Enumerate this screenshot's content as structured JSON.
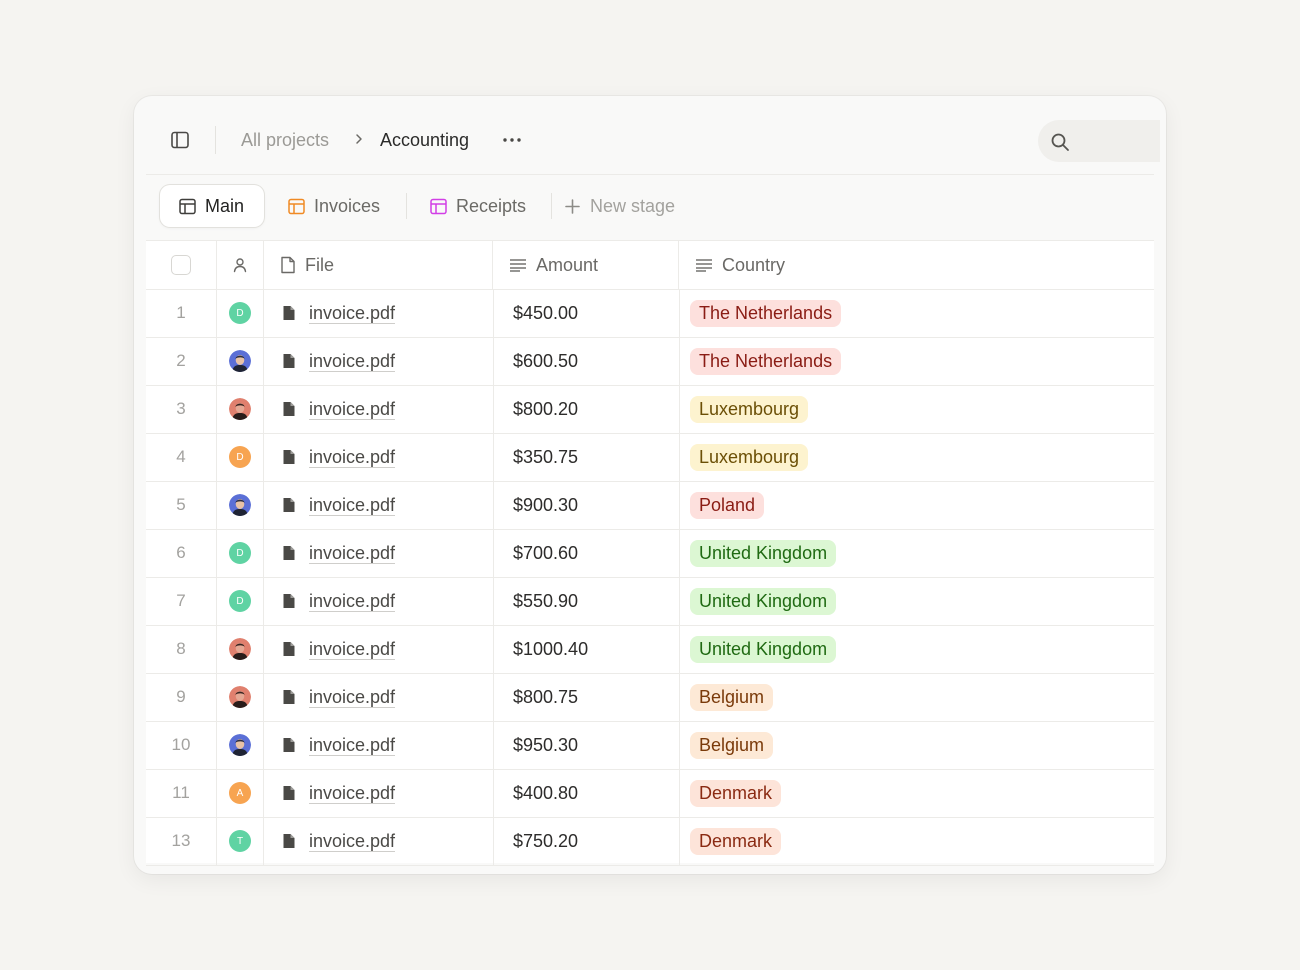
{
  "breadcrumb": {
    "root": "All projects",
    "current": "Accounting"
  },
  "icons": {
    "sidebar_toggle": "sidebar-toggle-icon",
    "more": "more-horizontal-icon",
    "search": "search-icon",
    "chevron": "chevron-right-icon"
  },
  "tabs": [
    {
      "label": "Main",
      "icon": "table-icon",
      "active": true,
      "color": "#6b6a66"
    },
    {
      "label": "Invoices",
      "icon": "table-icon",
      "active": false,
      "color": "#f08a24"
    },
    {
      "label": "Receipts",
      "icon": "table-icon",
      "active": false,
      "color": "#d23fe6"
    },
    {
      "label": "New stage",
      "icon": "plus-icon",
      "active": false
    }
  ],
  "table": {
    "columns": {
      "file": "File",
      "amount": "Amount",
      "country": "Country"
    },
    "rows": [
      {
        "num": "1",
        "avatar": {
          "type": "initial",
          "letter": "D",
          "color": "#5fd3a3"
        },
        "file": "invoice.pdf",
        "amount": "$450.00",
        "country": "The Netherlands"
      },
      {
        "num": "2",
        "avatar": {
          "type": "photo",
          "tone": "blue"
        },
        "file": "invoice.pdf",
        "amount": "$600.50",
        "country": "The Netherlands"
      },
      {
        "num": "3",
        "avatar": {
          "type": "photo",
          "tone": "red"
        },
        "file": "invoice.pdf",
        "amount": "$800.20",
        "country": "Luxembourg"
      },
      {
        "num": "4",
        "avatar": {
          "type": "initial",
          "letter": "D",
          "color": "#f7a451"
        },
        "file": "invoice.pdf",
        "amount": "$350.75",
        "country": "Luxembourg"
      },
      {
        "num": "5",
        "avatar": {
          "type": "photo",
          "tone": "blue"
        },
        "file": "invoice.pdf",
        "amount": "$900.30",
        "country": "Poland"
      },
      {
        "num": "6",
        "avatar": {
          "type": "initial",
          "letter": "D",
          "color": "#5fd3a3"
        },
        "file": "invoice.pdf",
        "amount": "$700.60",
        "country": "United Kingdom"
      },
      {
        "num": "7",
        "avatar": {
          "type": "initial",
          "letter": "D",
          "color": "#5fd3a3"
        },
        "file": "invoice.pdf",
        "amount": "$550.90",
        "country": "United Kingdom"
      },
      {
        "num": "8",
        "avatar": {
          "type": "photo",
          "tone": "red"
        },
        "file": "invoice.pdf",
        "amount": "$1000.40",
        "country": "United Kingdom"
      },
      {
        "num": "9",
        "avatar": {
          "type": "photo",
          "tone": "red"
        },
        "file": "invoice.pdf",
        "amount": "$800.75",
        "country": "Belgium"
      },
      {
        "num": "10",
        "avatar": {
          "type": "photo",
          "tone": "blue"
        },
        "file": "invoice.pdf",
        "amount": "$950.30",
        "country": "Belgium"
      },
      {
        "num": "11",
        "avatar": {
          "type": "initial",
          "letter": "A",
          "color": "#f7a451"
        },
        "file": "invoice.pdf",
        "amount": "$400.80",
        "country": "Denmark"
      },
      {
        "num": "13",
        "avatar": {
          "type": "initial",
          "letter": "T",
          "color": "#5fd3a3"
        },
        "file": "invoice.pdf",
        "amount": "$750.20",
        "country": "Denmark"
      }
    ]
  },
  "country_colors": {
    "The Netherlands": {
      "bg": "#fde0dd",
      "fg": "#8a1c14"
    },
    "Luxembourg": {
      "bg": "#fdf3cf",
      "fg": "#6b4f06"
    },
    "Poland": {
      "bg": "#fde0dd",
      "fg": "#8a1c14"
    },
    "United Kingdom": {
      "bg": "#dcf7d3",
      "fg": "#1f6a12"
    },
    "Belgium": {
      "bg": "#fde9d6",
      "fg": "#7a3a0a"
    },
    "Denmark": {
      "bg": "#fde4d9",
      "fg": "#8a2a12"
    }
  }
}
